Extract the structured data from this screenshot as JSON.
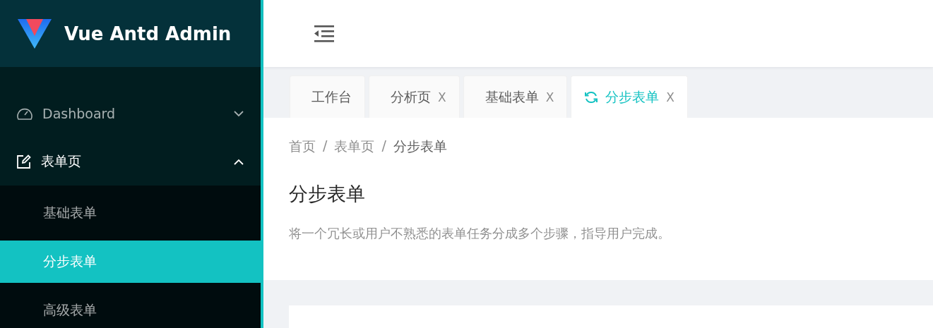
{
  "sidebar": {
    "brand": "Vue Antd Admin",
    "menu": [
      {
        "label": "Dashboard",
        "kind": "dashboard",
        "expanded": false
      },
      {
        "label": "表单页",
        "kind": "form",
        "expanded": true,
        "children": [
          {
            "label": "基础表单",
            "selected": false
          },
          {
            "label": "分步表单",
            "selected": true
          },
          {
            "label": "高级表单",
            "selected": false
          }
        ]
      }
    ]
  },
  "tabs": [
    {
      "label": "工作台",
      "selected": false
    },
    {
      "label": "分析页",
      "selected": false,
      "close": "X"
    },
    {
      "label": "基础表单",
      "selected": false,
      "close": "X"
    },
    {
      "label": "分步表单",
      "selected": true,
      "close": "X"
    }
  ],
  "breadcrumb": [
    "首页",
    "表单页",
    "分步表单"
  ],
  "breadcrumb_separator": "/",
  "page_header": {
    "title": "分步表单",
    "description": "将一个冗长或用户不熟悉的表单任务分成多个步骤，指导用户完成。"
  }
}
